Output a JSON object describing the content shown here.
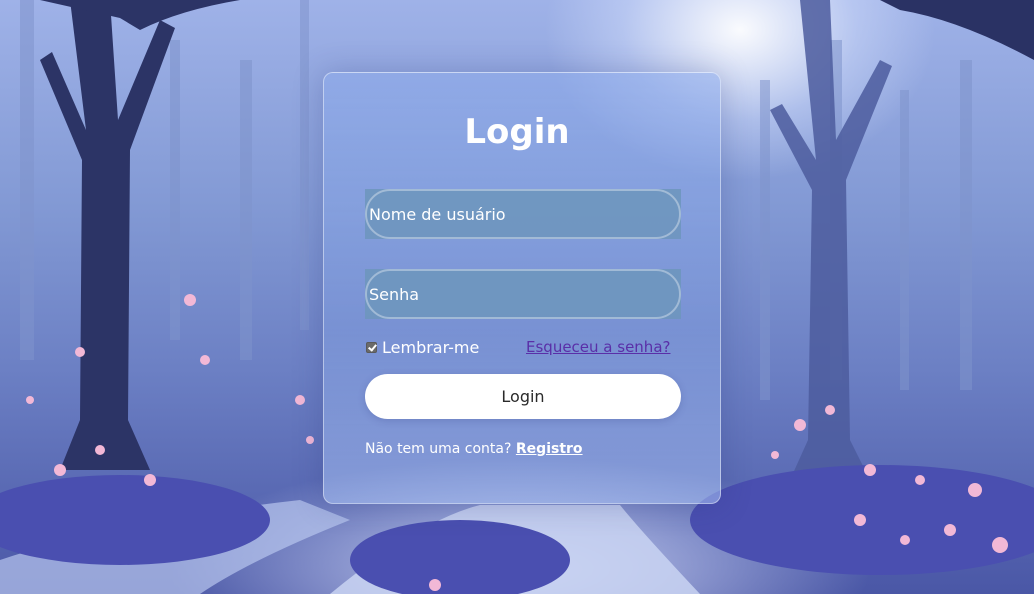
{
  "login_card": {
    "title": "Login",
    "username_placeholder": "Nome de usuário",
    "password_placeholder": "Senha",
    "remember_label": "Lembrar-me",
    "remember_checked": true,
    "forgot_link": "Esqueceu a senha?",
    "login_button": "Login",
    "no_account_text": "Não tem uma conta?",
    "register_link": "Registro"
  },
  "colors": {
    "card_tint": "#8caaeb",
    "input_fill": "#6e96be",
    "link_color": "#5a2fa8",
    "button_fill": "#ffffff"
  },
  "background": {
    "description_icon": "forest-scene"
  }
}
